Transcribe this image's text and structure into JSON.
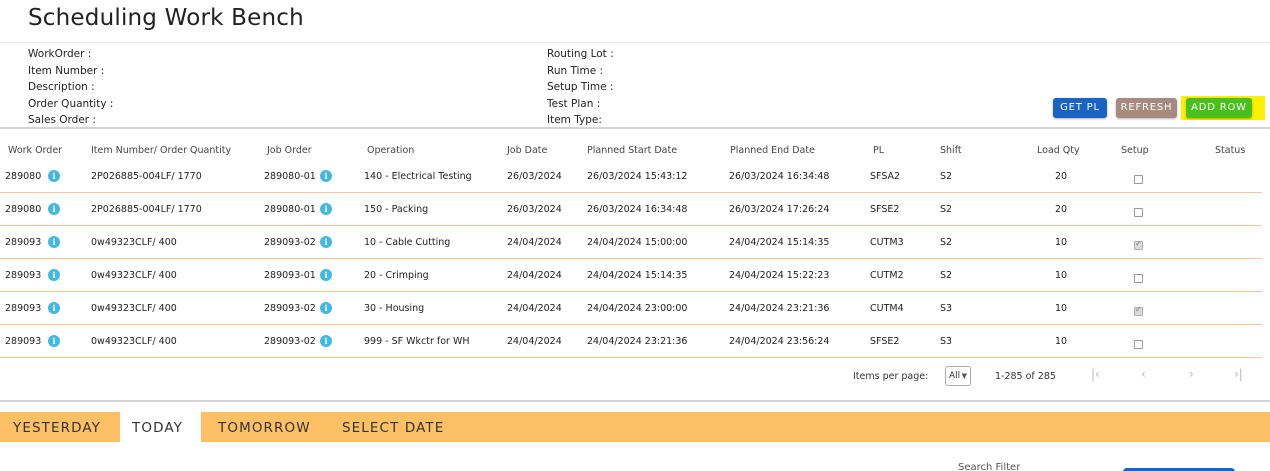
{
  "page": {
    "title": "Scheduling Work Bench"
  },
  "info": {
    "left": [
      "WorkOrder :",
      "Item Number :",
      "Description :",
      "Order Quantity :",
      "Sales Order :"
    ],
    "right": [
      "Routing Lot :",
      "Run Time :",
      "Setup Time :",
      "Test Plan :",
      "Item Type:"
    ]
  },
  "buttons": {
    "get_pl": "GET PL",
    "refresh": "REFRESH",
    "add_row": "ADD ROW"
  },
  "table": {
    "headers": [
      "Work Order",
      "Item Number/ Order Quantity",
      "Job Order",
      "Operation",
      "Job Date",
      "Planned Start Date",
      "Planned End Date",
      "PL",
      "Shift",
      "Load Qty",
      "Setup",
      "Status"
    ],
    "rows": [
      {
        "work_order": "289080",
        "item": "2P026885-004LF/ 1770",
        "job_order": "289080-01",
        "operation": "140 - Electrical Testing",
        "job_date": "26/03/2024",
        "start": "26/03/2024 15:43:12",
        "end": "26/03/2024 16:34:48",
        "pl": "SFSA2",
        "shift": "S2",
        "load_qty": "20",
        "setup": false,
        "status": ""
      },
      {
        "work_order": "289080",
        "item": "2P026885-004LF/ 1770",
        "job_order": "289080-01",
        "operation": "150 - Packing",
        "job_date": "26/03/2024",
        "start": "26/03/2024 16:34:48",
        "end": "26/03/2024 17:26:24",
        "pl": "SFSE2",
        "shift": "S2",
        "load_qty": "20",
        "setup": false,
        "status": ""
      },
      {
        "work_order": "289093",
        "item": "0w49323CLF/ 400",
        "job_order": "289093-02",
        "operation": "10 - Cable Cutting",
        "job_date": "24/04/2024",
        "start": "24/04/2024 15:00:00",
        "end": "24/04/2024 15:14:35",
        "pl": "CUTM3",
        "shift": "S2",
        "load_qty": "10",
        "setup": true,
        "status": ""
      },
      {
        "work_order": "289093",
        "item": "0w49323CLF/ 400",
        "job_order": "289093-01",
        "operation": "20 - Crimping",
        "job_date": "24/04/2024",
        "start": "24/04/2024 15:14:35",
        "end": "24/04/2024 15:22:23",
        "pl": "CUTM2",
        "shift": "S2",
        "load_qty": "10",
        "setup": false,
        "status": ""
      },
      {
        "work_order": "289093",
        "item": "0w49323CLF/ 400",
        "job_order": "289093-02",
        "operation": "30 - Housing",
        "job_date": "24/04/2024",
        "start": "24/04/2024 23:00:00",
        "end": "24/04/2024 23:21:36",
        "pl": "CUTM4",
        "shift": "S3",
        "load_qty": "10",
        "setup": true,
        "status": ""
      },
      {
        "work_order": "289093",
        "item": "0w49323CLF/ 400",
        "job_order": "289093-02",
        "operation": "999 - SF Wkctr for WH",
        "job_date": "24/04/2024",
        "start": "24/04/2024 23:21:36",
        "end": "24/04/2024 23:56:24",
        "pl": "SFSE2",
        "shift": "S3",
        "load_qty": "10",
        "setup": false,
        "status": ""
      }
    ]
  },
  "pager": {
    "label": "Items per page:",
    "selected": "All",
    "range": "1-285 of 285",
    "icons": [
      "first-page-icon",
      "prev-page-icon",
      "next-page-icon",
      "last-page-icon"
    ]
  },
  "tabs": [
    {
      "label": "YESTERDAY",
      "active": false
    },
    {
      "label": "TODAY",
      "active": true
    },
    {
      "label": "TOMORROW",
      "active": false
    },
    {
      "label": "SELECT DATE",
      "active": false
    }
  ],
  "cutoff_text": "Search Filter",
  "colors": {
    "primary": "#1a63c0",
    "refresh": "#a78b80",
    "add_row": "#4bbf1d",
    "highlight": "#ffef00",
    "tabbar": "#fec064",
    "info_icon": "#43b9de",
    "row_border": "#f2c7a3"
  }
}
